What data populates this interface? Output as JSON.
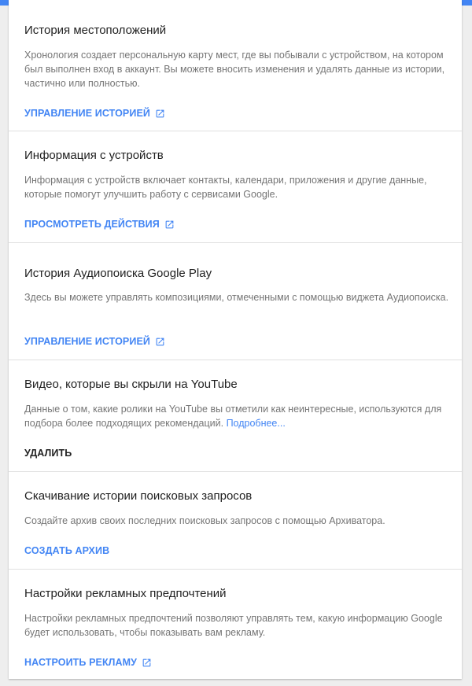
{
  "colors": {
    "accent": "#4285f4",
    "title": "#212121",
    "description": "#757575",
    "background": "#eeeeee"
  },
  "sections": [
    {
      "title": "История местоположений",
      "description": "Хронология создает персональную карту мест, где вы побывали с устройством, на котором был выполнен вход в аккаунт. Вы можете вносить изменения и удалять данные из истории, частично или полностью.",
      "action": "УПРАВЛЕНИЕ ИСТОРИЕЙ",
      "action_icon": "open-in-new-icon"
    },
    {
      "title": "Информация с устройств",
      "description": "Информация с устройств включает контакты, календари, приложения и другие данные, которые помогут улучшить работу с сервисами Google.",
      "action": "ПРОСМОТРЕТЬ ДЕЙСТВИЯ",
      "action_icon": "open-in-new-icon"
    },
    {
      "title": "История Аудиопоиска Google Play",
      "description": "Здесь вы можете управлять композициями, отмеченными с помощью виджета Аудиопоиска.",
      "action": "УПРАВЛЕНИЕ ИСТОРИЕЙ",
      "action_icon": "open-in-new-icon"
    },
    {
      "title": "Видео, которые вы скрыли на YouTube",
      "description": "Данные о том, какие ролики на YouTube вы отметили как неинтересные, используются для подбора более подходящих рекомендаций.",
      "more_link": "Подробнее...",
      "action": "УДАЛИТЬ"
    },
    {
      "title": "Скачивание истории поисковых запросов",
      "description": "Создайте архив своих последних поисковых запросов с помощью Архиватора.",
      "action": "СОЗДАТЬ АРХИВ"
    },
    {
      "title": "Настройки рекламных предпочтений",
      "description": "Настройки рекламных предпочтений позволяют управлять тем, какую информацию Google будет использовать, чтобы показывать вам рекламу.",
      "action": "НАСТРОИТЬ РЕКЛАМУ",
      "action_icon": "open-in-new-icon"
    }
  ]
}
